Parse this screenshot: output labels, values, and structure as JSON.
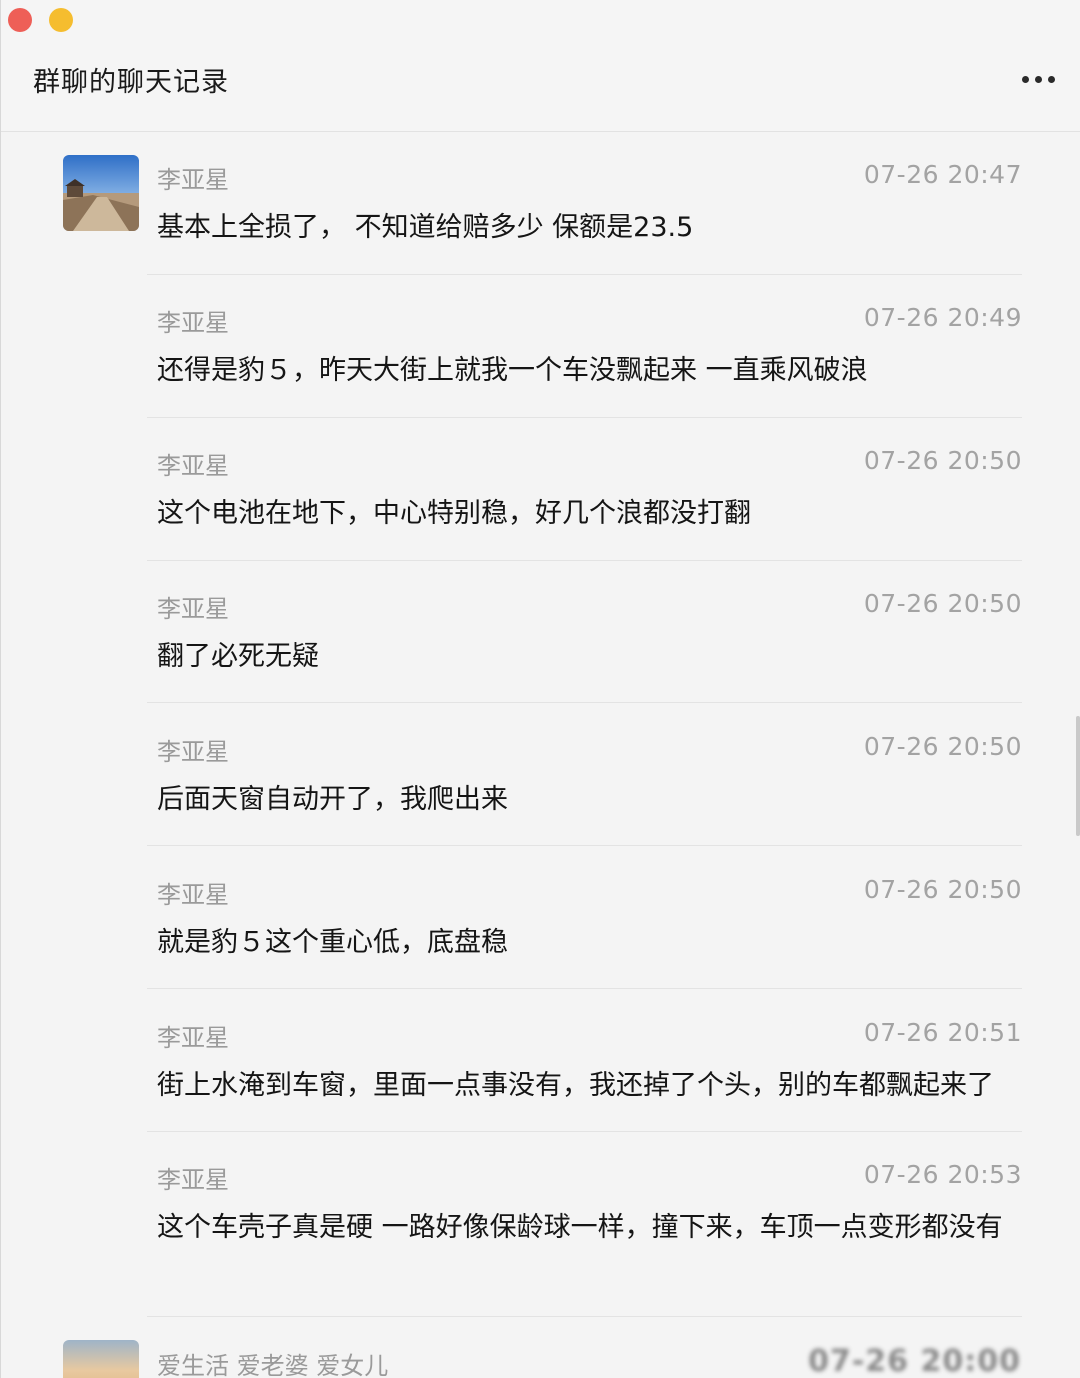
{
  "window": {
    "title": "群聊的聊天记录"
  },
  "messages": [
    {
      "sender": "李亚星",
      "time": "07-26 20:47",
      "text": "基本上全损了， 不知道给赔多少 保额是23.5",
      "avatar": "city-wall-photo"
    },
    {
      "sender": "李亚星",
      "time": "07-26 20:49",
      "text": "还得是豹５，昨天大街上就我一个车没飘起来  一直乘风破浪"
    },
    {
      "sender": "李亚星",
      "time": "07-26 20:50",
      "text": "这个电池在地下，中心特别稳，好几个浪都没打翻"
    },
    {
      "sender": "李亚星",
      "time": "07-26 20:50",
      "text": "翻了必死无疑"
    },
    {
      "sender": "李亚星",
      "time": "07-26 20:50",
      "text": "后面天窗自动开了，我爬出来"
    },
    {
      "sender": "李亚星",
      "time": "07-26 20:50",
      "text": "就是豹５这个重心低，底盘稳"
    },
    {
      "sender": "李亚星",
      "time": "07-26 20:51",
      "text": "街上水淹到车窗，里面一点事没有，我还掉了个头，别的车都飘起来了"
    },
    {
      "sender": "李亚星",
      "time": "07-26 20:53",
      "text": "这个车壳子真是硬 一路好像保龄球一样，撞下来，车顶一点变形都没有"
    },
    {
      "sender": "爱生活 爱老婆  爱女儿",
      "time": "07-26 20:00",
      "text": "",
      "avatar": "sunset-photo"
    }
  ],
  "colors": {
    "close": "#ee5f57",
    "minimize": "#f5bd2f",
    "background": "#f4f4f4"
  },
  "icons": {
    "menu": "more-dots-icon"
  }
}
